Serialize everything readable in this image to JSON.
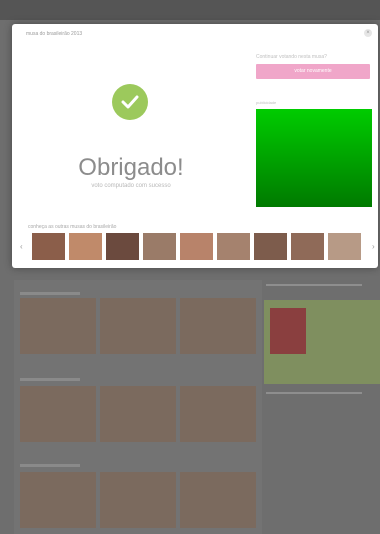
{
  "modal": {
    "title": "musa do brasileirão 2013",
    "close_glyph": "×",
    "thanks_title": "Obrigado!",
    "thanks_subtitle": "voto computado com sucesso",
    "continue_label": "Continuar votando nesta musa?",
    "vote_again_label": "votar novamente",
    "ad_label": "publicidade",
    "strip_label": "conheça as outras musas do brasileirão",
    "prev_arrow": "‹",
    "next_arrow": "›",
    "ad_color": "#00b300",
    "accent_pink": "#f0a6c9",
    "check_color": "#9cc95c"
  },
  "strip_thumbs": [
    {
      "name": "musa-1",
      "color": "#8b5e4a"
    },
    {
      "name": "musa-2",
      "color": "#c08a6a"
    },
    {
      "name": "musa-3",
      "color": "#6b4a3e"
    },
    {
      "name": "musa-4",
      "color": "#9a7b68"
    },
    {
      "name": "musa-5",
      "color": "#b8836a"
    },
    {
      "name": "musa-6",
      "color": "#a5826e"
    },
    {
      "name": "musa-7",
      "color": "#7d5c4c"
    },
    {
      "name": "musa-8",
      "color": "#8f6a58"
    },
    {
      "name": "musa-9",
      "color": "#b79a86"
    }
  ]
}
